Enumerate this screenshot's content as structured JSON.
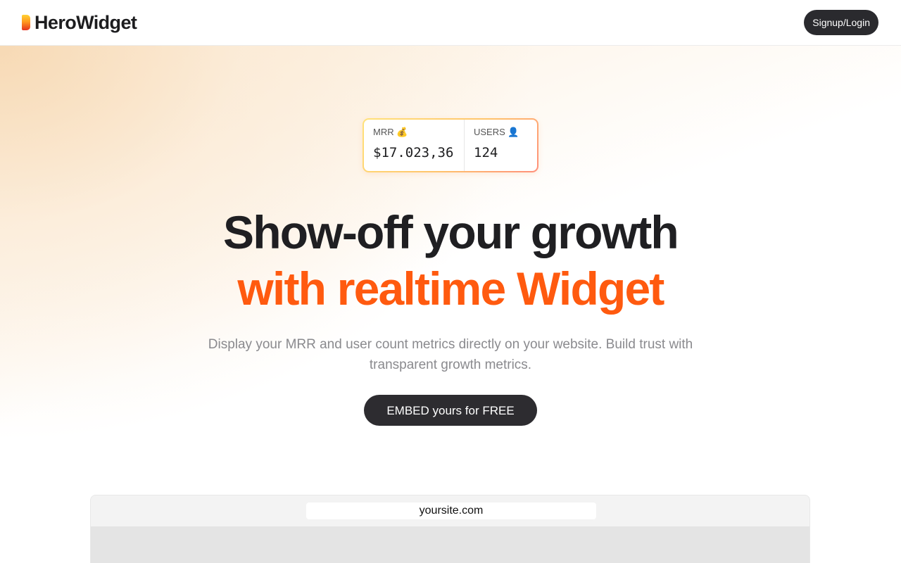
{
  "header": {
    "brand": "HeroWidget",
    "login_label": "Signup/Login"
  },
  "widget": {
    "mrr_label": "MRR 💰",
    "mrr_value": "$17.023,36",
    "users_label": "USERS 👤",
    "users_value": "124"
  },
  "hero": {
    "title_line1": "Show-off your growth",
    "title_line2": "with realtime Widget",
    "subtitle": "Display your MRR and user count metrics directly on your website. Build trust with transparent growth metrics.",
    "cta_label": "EMBED yours for FREE"
  },
  "preview": {
    "url": "yoursite.com"
  },
  "colors": {
    "accent": "#ff5a0f",
    "dark": "#2d2c30"
  }
}
